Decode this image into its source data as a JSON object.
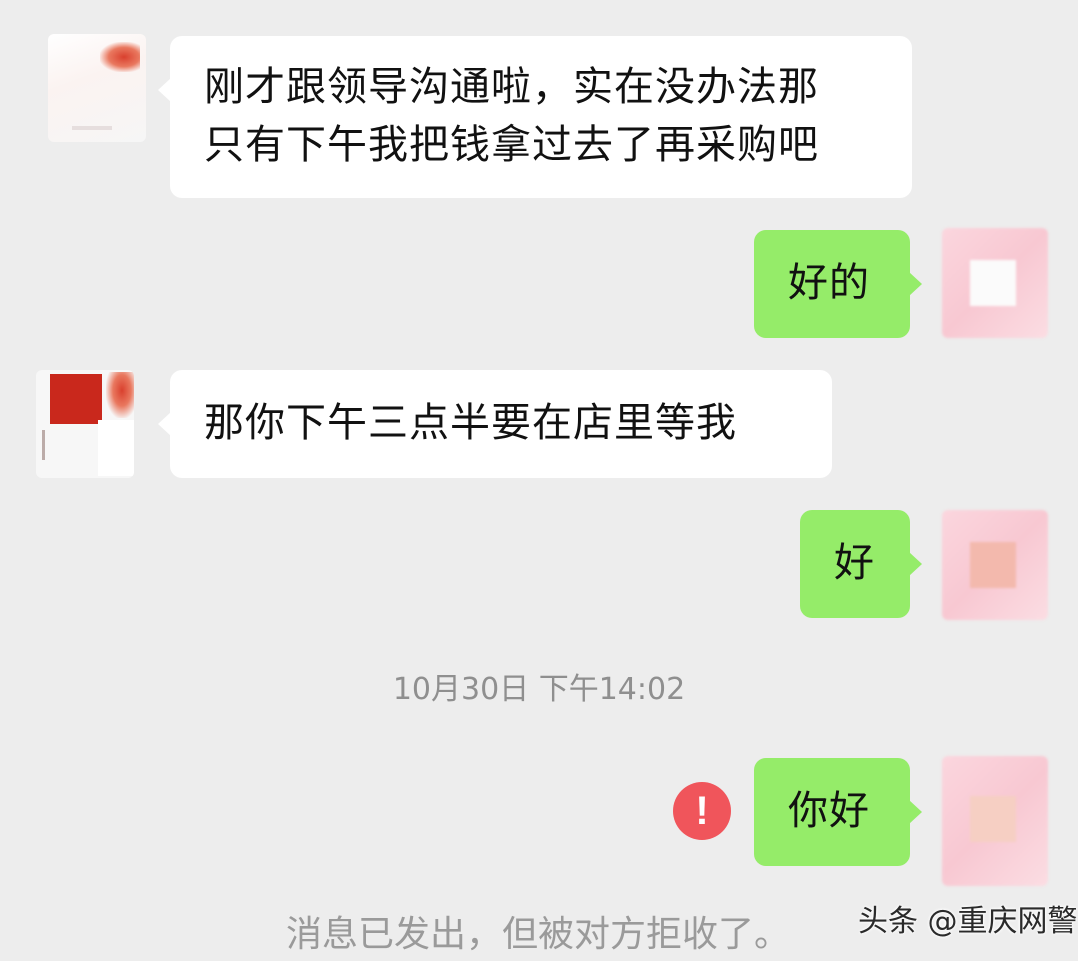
{
  "messages": [
    {
      "from": "contact",
      "lines": [
        "刚才跟领导沟通啦，实在没办法那",
        "只有下午我把钱拿过去了再采购吧"
      ]
    },
    {
      "from": "me",
      "text": "好的"
    },
    {
      "from": "contact",
      "text": "那你下午三点半要在店里等我"
    },
    {
      "from": "me",
      "text": "好"
    },
    {
      "from": "me",
      "text": "你好",
      "status": "rejected"
    }
  ],
  "timestamp": "10月30日 下午14:02",
  "error_icon": {
    "symbol": "!",
    "color": "#f0555b"
  },
  "system_note": "消息已发出，但被对方拒收了。",
  "watermark": "头条 @重庆网警",
  "colors": {
    "background": "#ededed",
    "incoming_bubble": "#ffffff",
    "outgoing_bubble": "#95ec69",
    "secondary_text": "#8f8f8f"
  }
}
